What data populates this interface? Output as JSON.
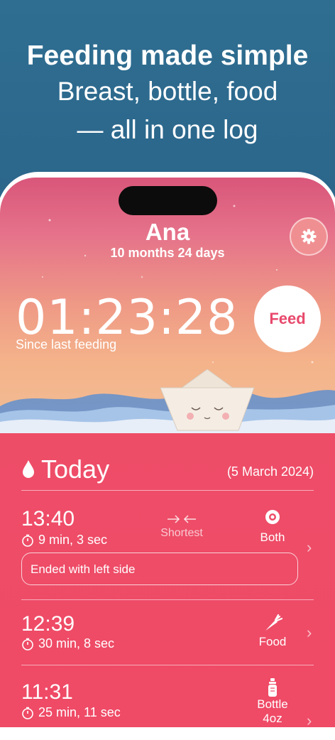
{
  "promo": {
    "title": "Feeding made simple",
    "line1": "Breast, bottle, food",
    "line2": "— all in one log"
  },
  "baby": {
    "name": "Ana",
    "age": "10 months 24 days"
  },
  "timer": {
    "elapsed": "01:23:28",
    "caption": "Since last feeding"
  },
  "feed_button": "Feed",
  "today": {
    "label": "Today",
    "date": "(5 March 2024)"
  },
  "entries": [
    {
      "time": "13:40",
      "duration": "9 min, 3 sec",
      "badge": "Shortest",
      "type": "Both",
      "note": "Ended with left side"
    },
    {
      "time": "12:39",
      "duration": "30 min, 8 sec",
      "type": "Food"
    },
    {
      "time": "11:31",
      "duration": "25 min, 11 sec",
      "type_line1": "Bottle",
      "type_line2": "4oz"
    }
  ],
  "colors": {
    "accent": "#ee4d68",
    "bg_top": "#2f6e91",
    "feed_text": "#e8496c"
  },
  "icons": [
    "gear-icon",
    "drop-icon",
    "stopwatch-icon",
    "arrows-inward-icon",
    "target-icon",
    "carrot-icon",
    "bottle-icon",
    "chevron-right-icon"
  ]
}
